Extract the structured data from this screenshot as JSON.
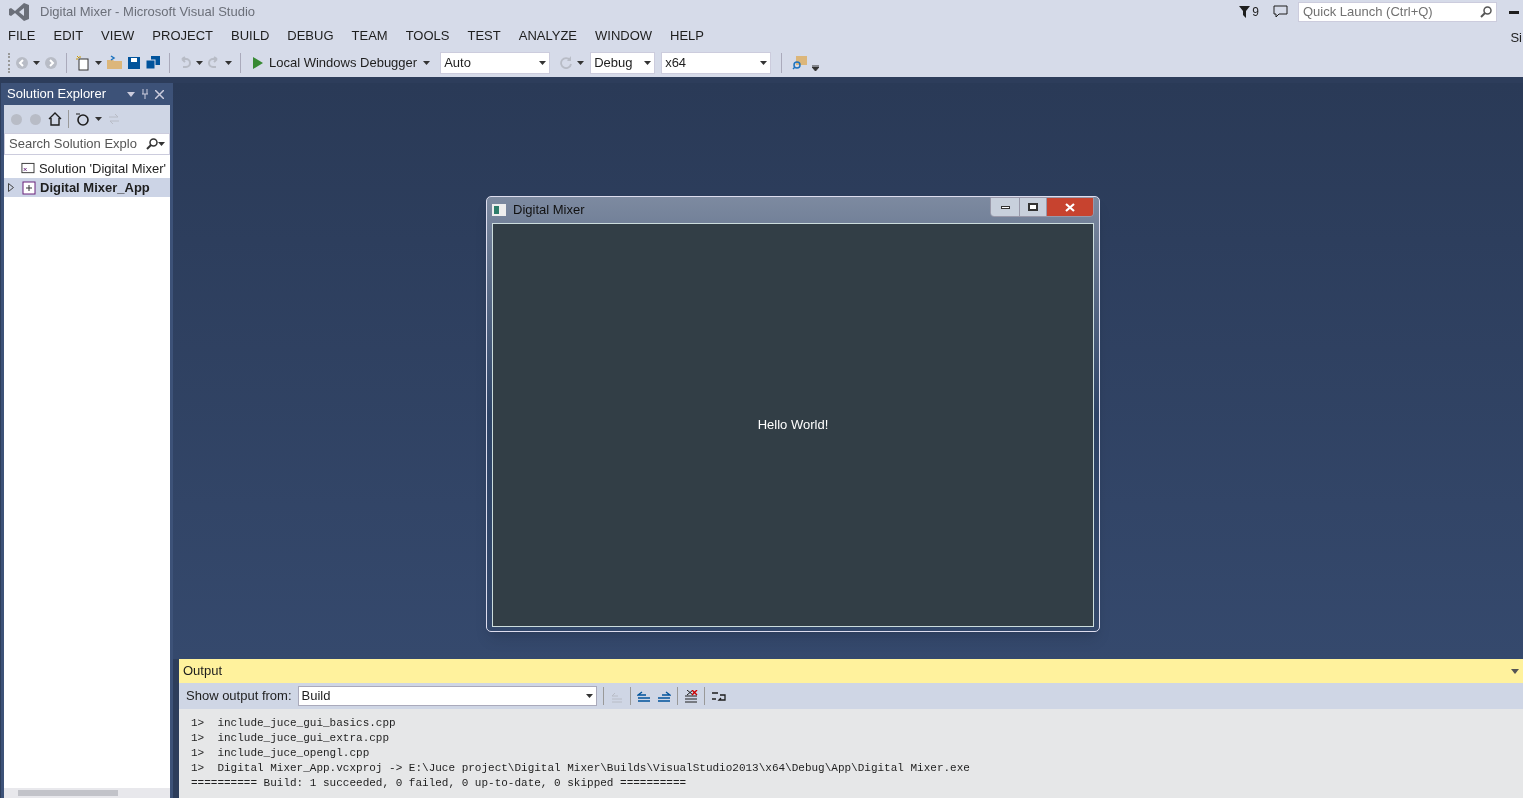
{
  "window": {
    "title": "Digital Mixer - Microsoft Visual Studio",
    "notification_count": "9",
    "quick_launch": {
      "placeholder": "Quick Launch (Ctrl+Q)"
    },
    "edge_text": "Si"
  },
  "menu": [
    "FILE",
    "EDIT",
    "VIEW",
    "PROJECT",
    "BUILD",
    "DEBUG",
    "TEAM",
    "TOOLS",
    "TEST",
    "ANALYZE",
    "WINDOW",
    "HELP"
  ],
  "toolbar": {
    "debugger": "Local Windows Debugger",
    "combos": [
      {
        "value": "Auto",
        "kind": "wide"
      },
      {
        "value": "Debug",
        "kind": "narrow"
      },
      {
        "value": "x64",
        "kind": "wide"
      }
    ]
  },
  "solution_explorer": {
    "title": "Solution Explorer",
    "search": {
      "placeholder": "Search Solution Explo"
    },
    "tree": [
      {
        "label": "Solution 'Digital Mixer'",
        "kind": "solution",
        "selected": false,
        "children": [
          {
            "label": "Digital Mixer_App",
            "kind": "project",
            "selected": true,
            "expanded": false
          }
        ]
      }
    ]
  },
  "app_window": {
    "title": "Digital Mixer",
    "message": "Hello World!"
  },
  "output": {
    "title": "Output",
    "source_label": "Show output from:",
    "source": "Build",
    "lines": [
      "1>  include_juce_gui_basics.cpp",
      "1>  include_juce_gui_extra.cpp",
      "1>  include_juce_opengl.cpp",
      "1>  Digital Mixer_App.vcxproj -> E:\\Juce project\\Digital Mixer\\Builds\\VisualStudio2013\\x64\\Debug\\App\\Digital Mixer.exe",
      "========== Build: 1 succeeded, 0 failed, 0 up-to-date, 0 skipped =========="
    ]
  }
}
